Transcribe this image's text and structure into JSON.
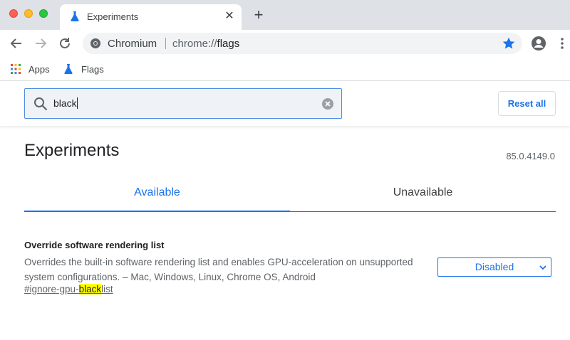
{
  "browser": {
    "tab": {
      "title": "Experiments",
      "close_glyph": "✕",
      "icon": "flask-icon"
    },
    "new_tab_glyph": "+",
    "omnibox": {
      "site_name": "Chromium",
      "url_scheme": "chrome://",
      "url_host": "flags"
    },
    "bookmarks": [
      {
        "label": "Apps",
        "icon": "apps-grid-icon"
      },
      {
        "label": "Flags",
        "icon": "flask-icon"
      }
    ],
    "colors": {
      "accent": "#1a73e8",
      "tabstrip": "#dee1e6"
    }
  },
  "flags": {
    "search": {
      "value": "black"
    },
    "reset_label": "Reset all",
    "title": "Experiments",
    "version": "85.0.4149.0",
    "tabs": [
      {
        "label": "Available",
        "selected": true
      },
      {
        "label": "Unavailable",
        "selected": false
      }
    ],
    "experiment": {
      "name": "Override software rendering list",
      "description": "Overrides the built-in software rendering list and enables GPU-acceleration on unsupported system configurations. – Mac, Windows, Linux, Chrome OS, Android",
      "link_prefix": "#ignore-gpu-",
      "link_highlight": "black",
      "link_suffix": "list",
      "selected_option": "Disabled"
    }
  }
}
